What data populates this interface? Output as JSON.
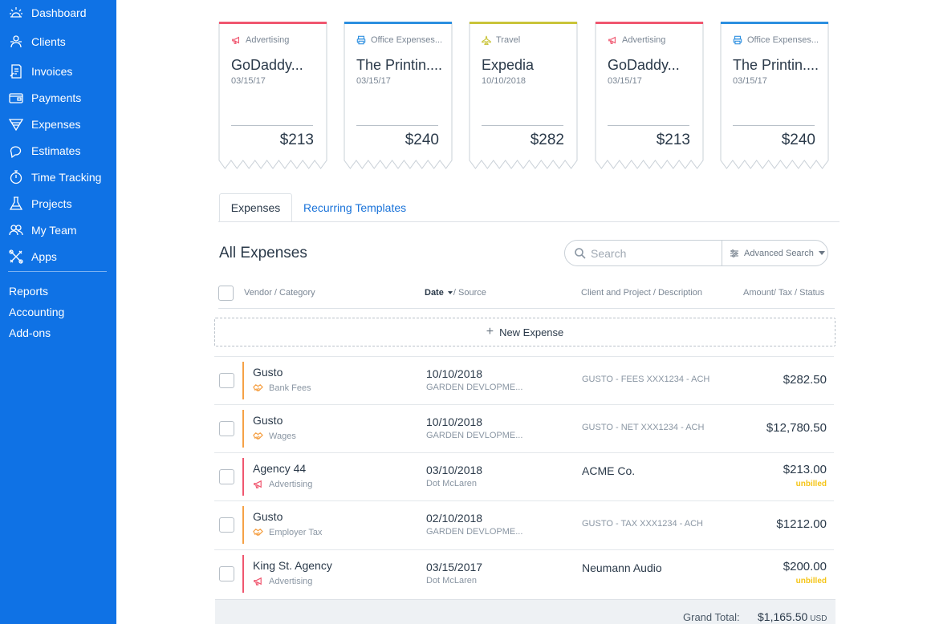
{
  "sidebar": {
    "items": [
      {
        "label": "Dashboard",
        "icon": "dashboard-icon"
      },
      {
        "label": "Clients",
        "icon": "clients-icon"
      },
      {
        "label": "Invoices",
        "icon": "invoices-icon"
      },
      {
        "label": "Payments",
        "icon": "payments-icon"
      },
      {
        "label": "Expenses",
        "icon": "expenses-icon"
      },
      {
        "label": "Estimates",
        "icon": "estimates-icon"
      },
      {
        "label": "Time Tracking",
        "icon": "stopwatch-icon"
      },
      {
        "label": "Projects",
        "icon": "flask-icon"
      },
      {
        "label": "My Team",
        "icon": "team-icon"
      },
      {
        "label": "Apps",
        "icon": "apps-icon"
      }
    ],
    "links": [
      "Reports",
      "Accounting",
      "Add-ons"
    ]
  },
  "colors": {
    "sidebar": "#0f72e5",
    "advertising": "#f0566f",
    "office": "#2c8fe0",
    "travel": "#c9c43a",
    "bank": "#f5a146",
    "unbilled": "#f5c518",
    "link": "#1a73d9"
  },
  "cards": [
    {
      "category": "Advertising",
      "vendor": "GoDaddy...",
      "date": "03/15/17",
      "amount": "$213",
      "kind": "advertising"
    },
    {
      "category": "Office Expenses...",
      "vendor": "The Printin....",
      "date": "03/15/17",
      "amount": "$240",
      "kind": "office"
    },
    {
      "category": "Travel",
      "vendor": "Expedia",
      "date": "10/10/2018",
      "amount": "$282",
      "kind": "travel"
    },
    {
      "category": "Advertising",
      "vendor": "GoDaddy...",
      "date": "03/15/17",
      "amount": "$213",
      "kind": "advertising"
    },
    {
      "category": "Office Expenses...",
      "vendor": "The Printin....",
      "date": "03/15/17",
      "amount": "$240",
      "kind": "office"
    }
  ],
  "tabs": {
    "expenses": "Expenses",
    "recurring": "Recurring Templates"
  },
  "main": {
    "title": "All Expenses",
    "search_placeholder": "Search",
    "advanced_search": "Advanced Search",
    "new_expense": "New Expense"
  },
  "columns": {
    "vendor": "Vendor / Category",
    "date": "Date",
    "source": "/ Source",
    "client": "Client and Project / Description",
    "amount": "Amount/ Tax / Status"
  },
  "rows": [
    {
      "vendor": "Gusto",
      "category": "Bank Fees",
      "date": "10/10/2018",
      "source": "GARDEN DEVLOPME...",
      "desc": "GUSTO - FEES XXX1234 - ACH",
      "amount": "$282.50",
      "status": "",
      "kind": "bank"
    },
    {
      "vendor": "Gusto",
      "category": "Wages",
      "date": "10/10/2018",
      "source": "GARDEN DEVLOPME...",
      "desc": "GUSTO - NET XXX1234 - ACH",
      "amount": "$12,780.50",
      "status": "",
      "kind": "bank"
    },
    {
      "vendor": "Agency 44",
      "category": "Advertising",
      "date": "03/10/2018",
      "source": "Dot McLaren",
      "desc": "ACME Co.",
      "amount": "$213.00",
      "status": "unbilled",
      "kind": "advertising"
    },
    {
      "vendor": "Gusto",
      "category": "Employer Tax",
      "date": "02/10/2018",
      "source": "GARDEN DEVLOPME...",
      "desc": "GUSTO - TAX XXX1234 - ACH",
      "amount": "$1212.00",
      "status": "",
      "kind": "bank"
    },
    {
      "vendor": "King St. Agency",
      "category": "Advertising",
      "date": "03/15/2017",
      "source": "Dot McLaren",
      "desc": "Neumann Audio",
      "amount": "$200.00",
      "status": "unbilled",
      "kind": "advertising"
    }
  ],
  "total": {
    "label": "Grand Total:",
    "value": "$1,165.50",
    "currency": "USD"
  }
}
